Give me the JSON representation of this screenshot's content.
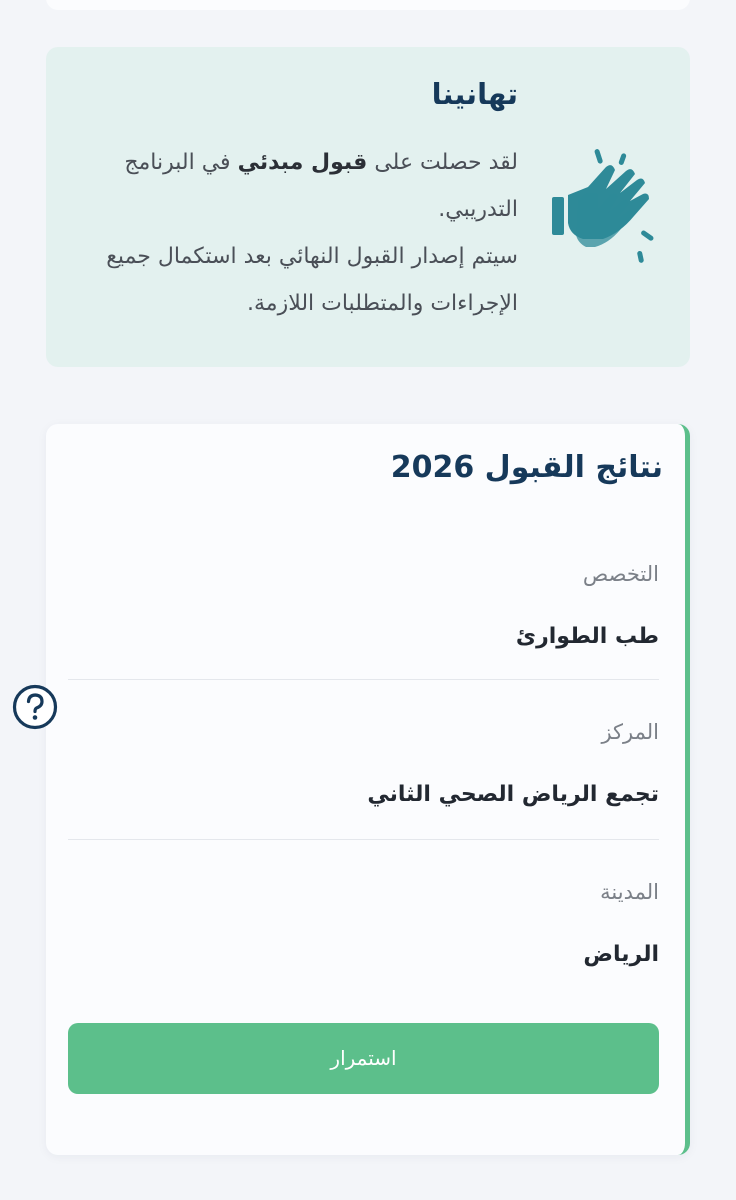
{
  "congrats": {
    "title": "تهانينا",
    "line1_prefix": "لقد حصلت على ",
    "line1_bold": "قبول مبدئي",
    "line1_suffix": " في البرنامج التدريبي.",
    "line2": "سيتم إصدار القبول النهائي بعد استكمال جميع الإجراءات والمتطلبات اللازمة.",
    "icon": "clapping-hands-icon"
  },
  "results": {
    "title": "نتائج القبول 2026",
    "fields": [
      {
        "label": "التخصص",
        "value": "طب الطوارئ"
      },
      {
        "label": "المركز",
        "value": "تجمع الرياض الصحي الثاني"
      },
      {
        "label": "المدينة",
        "value": "الرياض"
      }
    ],
    "continue_label": "استمرار"
  },
  "help": {
    "icon": "help-question-icon"
  },
  "colors": {
    "navy": "#16395a",
    "green": "#5cbf8b",
    "mint_background": "#e3f1ef",
    "teal_icon": "#2e8a98"
  }
}
